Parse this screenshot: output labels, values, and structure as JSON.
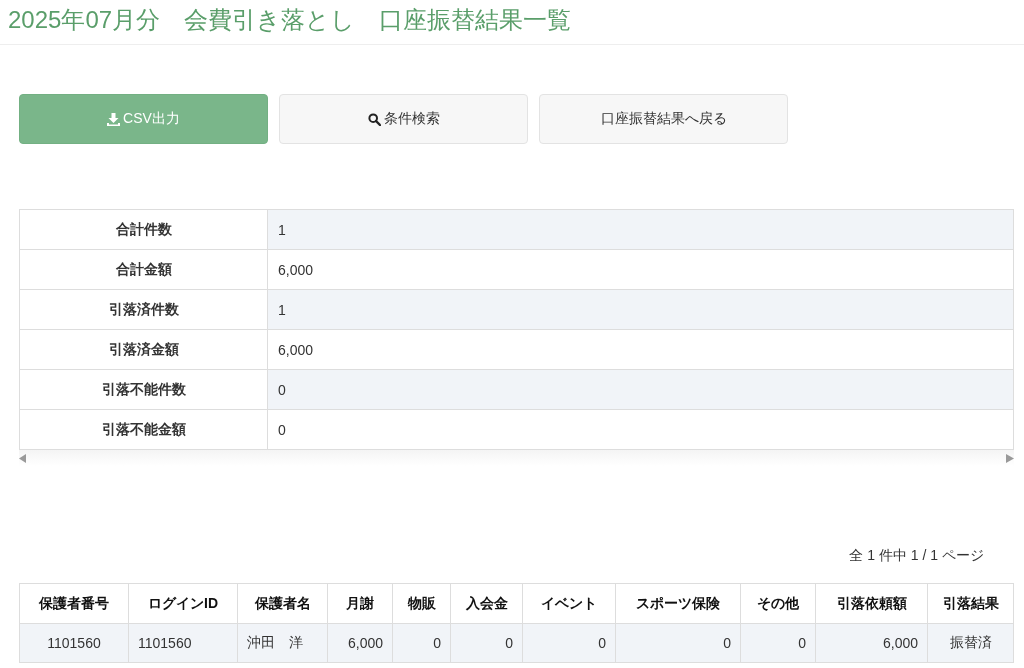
{
  "page_title": "2025年07月分　会費引き落とし　口座振替結果一覧",
  "buttons": [
    {
      "label": "CSV出力",
      "kind": "primary"
    },
    {
      "label": "条件検索",
      "kind": "default"
    },
    {
      "label": "口座振替結果へ戻る",
      "kind": "default"
    }
  ],
  "summary": [
    {
      "label": "合計件数",
      "value": "1"
    },
    {
      "label": "合計金額",
      "value": "6,000"
    },
    {
      "label": "引落済件数",
      "value": "1"
    },
    {
      "label": "引落済金額",
      "value": "6,000"
    },
    {
      "label": "引落不能件数",
      "value": "0"
    },
    {
      "label": "引落不能金額",
      "value": "0"
    }
  ],
  "pagination_info": "全 1 件中 1 / 1 ページ",
  "table": {
    "columns": [
      "保護者番号",
      "ログインID",
      "保護者名",
      "月謝",
      "物販",
      "入会金",
      "イベント",
      "スポーツ保険",
      "その他",
      "引落依頼額",
      "引落結果"
    ],
    "rows": [
      [
        "1101560",
        "1101560",
        "沖田　洋",
        "6,000",
        "0",
        "0",
        "0",
        "0",
        "0",
        "6,000",
        "振替済"
      ]
    ]
  }
}
